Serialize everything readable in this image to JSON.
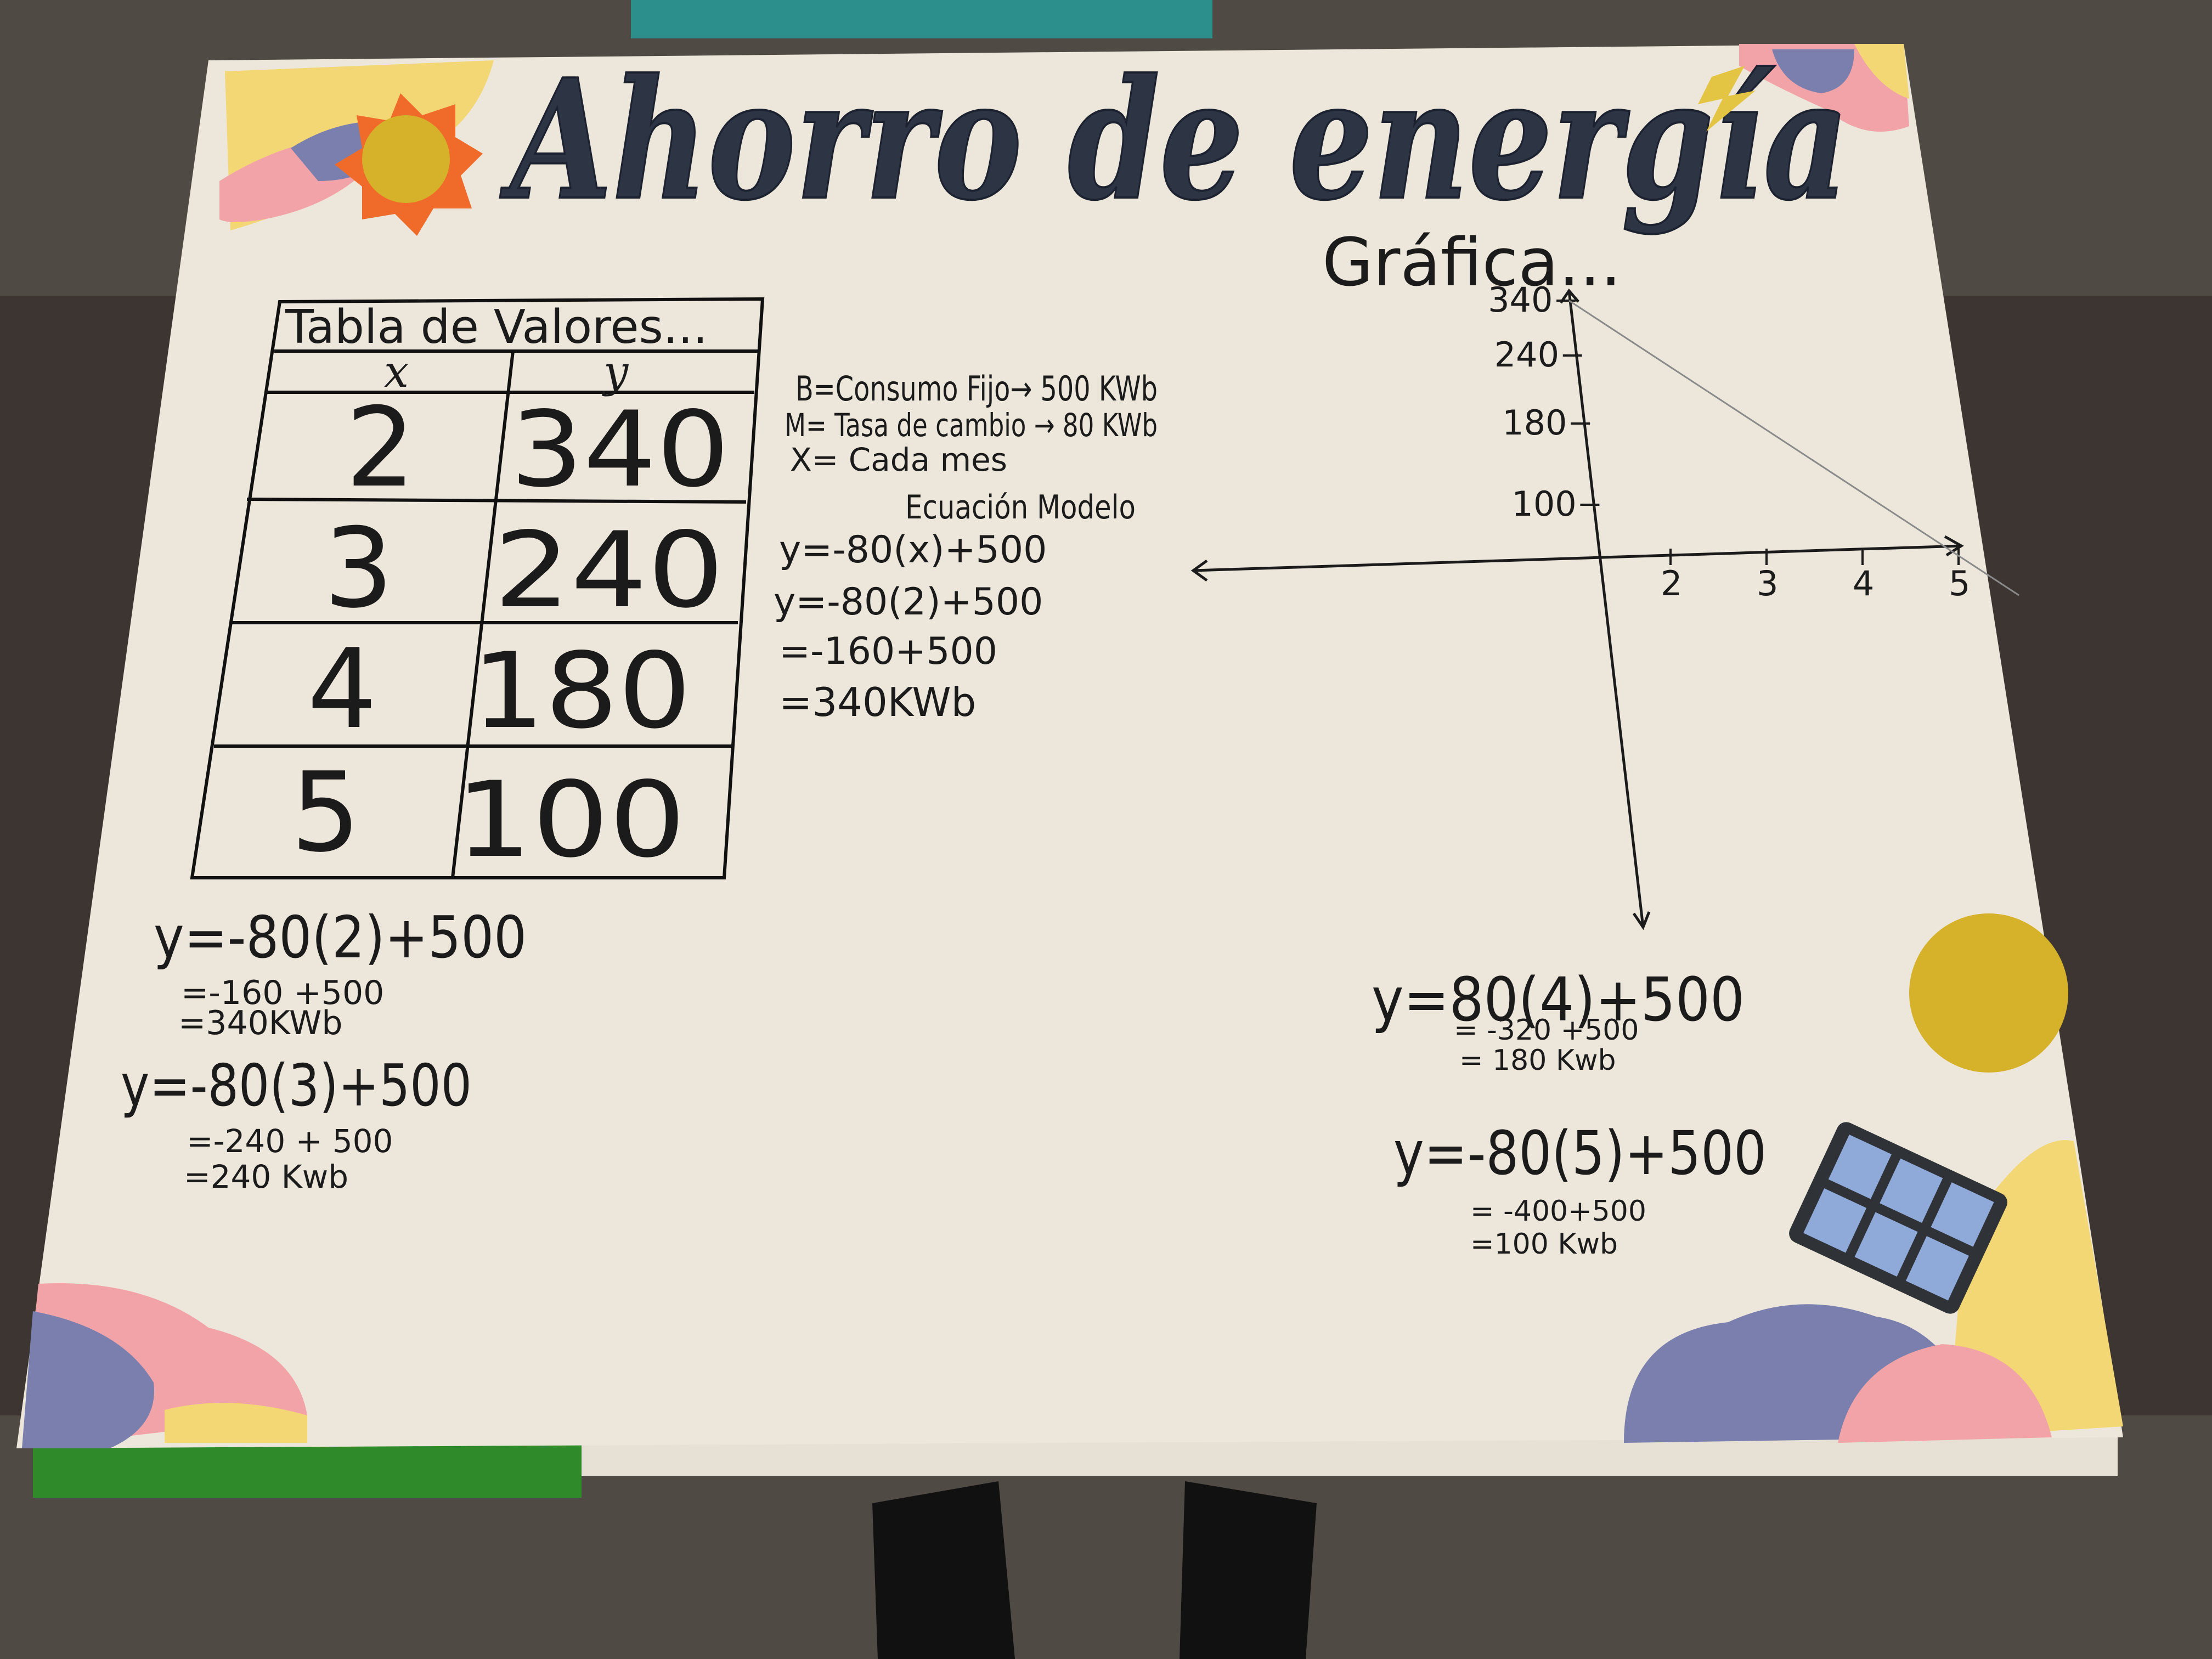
{
  "poster": {
    "title": "Ahorro de energía",
    "chart_heading": "Gráfica...",
    "table": {
      "caption": "Tabla de Valores...",
      "headers": [
        "x",
        "y"
      ],
      "rows": [
        [
          "2",
          "340"
        ],
        [
          "3",
          "240"
        ],
        [
          "4",
          "180"
        ],
        [
          "5",
          "100"
        ]
      ]
    },
    "definitions": [
      "B=Consumo Fijo→ 500 KWb",
      "M= Tasa de cambio → 80 KWb",
      "X= Cada mes"
    ],
    "model": {
      "heading": "Ecuación Modelo",
      "lines": [
        "y=-80(x)+500",
        "y=-80(2)+500",
        "=-160+500",
        "=340KWb"
      ]
    },
    "left_calcs": [
      {
        "equation": "y=-80(2)+500",
        "step1": "=-160 +500",
        "step2": "=340KWb"
      },
      {
        "equation": "y=-80(3)+500",
        "step1": "=-240 + 500",
        "step2": "=240 Kwb"
      }
    ],
    "right_calcs": [
      {
        "equation": "y=80(4)+500",
        "step1": "= -320 +500",
        "step2": "= 180 Kwb"
      },
      {
        "equation": "y=-80(5)+500",
        "step1": "= -400+500",
        "step2": "=100 Kwb"
      }
    ]
  },
  "chart_data": {
    "type": "line",
    "title": "Gráfica...",
    "xlabel": "",
    "ylabel": "",
    "x_ticks": [
      2,
      3,
      4,
      5
    ],
    "y_ticks": [
      340,
      240,
      180,
      100
    ],
    "series": [
      {
        "x": [
          2,
          3,
          4,
          5
        ],
        "y": [
          340,
          240,
          180,
          100
        ]
      }
    ]
  },
  "colors": {
    "poster": "#ece7da",
    "title_glitter": "#2d3444",
    "ink": "#1b1b1b",
    "pink": "#f2a3a8",
    "lavender": "#7a7fae",
    "yellow": "#f3d774",
    "gold": "#d6b12a",
    "orange": "#f06a2a"
  }
}
